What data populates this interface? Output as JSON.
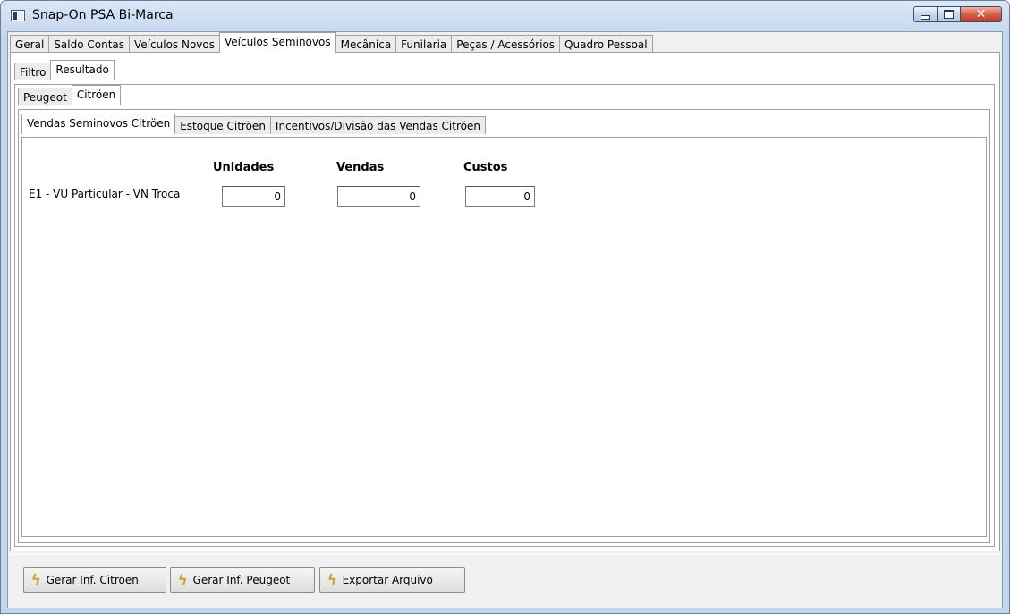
{
  "window": {
    "title": "Snap-On PSA Bi-Marca"
  },
  "main_tabs": [
    "Geral",
    "Saldo Contas",
    "Veículos Novos",
    "Veículos Seminovos",
    "Mecânica",
    "Funilaria",
    "Peças / Acessórios",
    "Quadro Pessoal"
  ],
  "main_tabs_active": "Veículos Seminovos",
  "sub_tabs": [
    "Filtro",
    "Resultado"
  ],
  "sub_tabs_active": "Resultado",
  "brand_tabs": [
    "Peugeot",
    "Citröen"
  ],
  "brand_tabs_active": "Citröen",
  "report_tabs": [
    "Vendas Seminovos Citröen",
    "Estoque Citröen",
    "Incentivos/Divisão das Vendas Citröen"
  ],
  "report_tabs_active": "Vendas Seminovos Citröen",
  "grid": {
    "headers": [
      "Unidades",
      "Vendas",
      "Custos"
    ],
    "rows": [
      {
        "label": "E1 - VU Particular - VN Troca",
        "values": [
          "0",
          "0",
          "0"
        ]
      }
    ]
  },
  "buttons": [
    "Gerar Inf. Citroen",
    "Gerar Inf. Peugeot",
    "Exportar Arquivo"
  ],
  "icons": {
    "button_icon": "lightning-bolt-icon",
    "app_icon": "app-window-icon"
  }
}
